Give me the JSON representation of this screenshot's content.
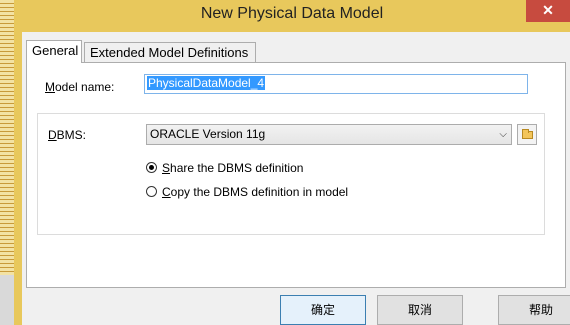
{
  "window": {
    "title": "New Physical Data Model",
    "close_symbol": "✕"
  },
  "tabs": [
    {
      "label": "General",
      "active": true
    },
    {
      "label": "Extended Model Definitions",
      "active": false
    }
  ],
  "form": {
    "model_name_label_u": "M",
    "model_name_label_rest": "odel name:",
    "model_name_value": "PhysicalDataModel_4",
    "dbms_label_u": "D",
    "dbms_label_rest": "BMS:",
    "dbms_selected": "ORACLE Version 11g",
    "radio_share_u": "S",
    "radio_share_rest": "hare the DBMS definition",
    "radio_copy_u": "C",
    "radio_copy_rest": "opy the DBMS definition in model",
    "selected_option": "share"
  },
  "buttons": {
    "ok": "确定",
    "cancel": "取消",
    "help": "帮助"
  },
  "icons": {
    "dropdown": "chevron-down-icon",
    "browse": "folder-icon"
  },
  "colors": {
    "titlebar": "#e8c85c",
    "close": "#c74b3f",
    "selection": "#3399ff"
  }
}
